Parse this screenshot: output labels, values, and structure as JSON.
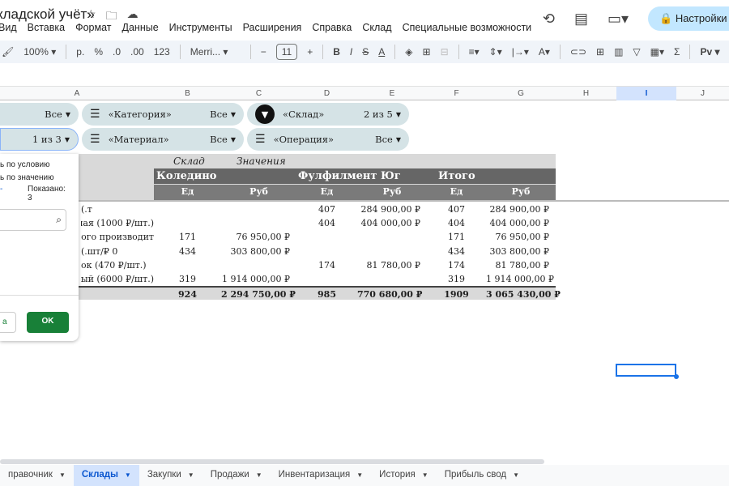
{
  "doc": {
    "title": "кладской учёт»"
  },
  "menu": [
    "Вид",
    "Вставка",
    "Формат",
    "Данные",
    "Инструменты",
    "Расширения",
    "Справка",
    "Склад",
    "Специальные возможности"
  ],
  "header": {
    "share_label": "Настройки Д"
  },
  "toolbar": {
    "zoom": "100%",
    "currency": "р.",
    "percent": "%",
    "dec_less": ".0",
    "dec_more": ".00",
    "format_123": "123",
    "font": "Merri...",
    "font_size": "11",
    "script": "Рv"
  },
  "columns": [
    "A",
    "B",
    "C",
    "D",
    "E",
    "F",
    "G",
    "H",
    "I",
    "J"
  ],
  "filters": {
    "row1": [
      {
        "label": "",
        "value": "Все"
      },
      {
        "label": "«Категория»",
        "value": "Все"
      },
      {
        "label": "«Склад»",
        "value": "2 из 5"
      }
    ],
    "row2": [
      {
        "label": "",
        "value": "1 из 3"
      },
      {
        "label": "«Материал»",
        "value": "Все"
      },
      {
        "label": "«Операция»",
        "value": "Все"
      }
    ]
  },
  "pivot": {
    "col_field": "Склад",
    "values_field": "Значения",
    "groups": [
      "Коледино",
      "Фулфилмент Юг",
      "Итого"
    ],
    "sub": [
      "Ед",
      "Руб",
      "Ед",
      "Руб",
      "Ед",
      "Руб"
    ],
    "rows": [
      {
        "label": "т.)",
        "c": [
          "",
          "",
          "407",
          "284 900,00 ₽",
          "407",
          "284 900,00 ₽"
        ]
      },
      {
        "label": "тная (1000 ₽/шт.)",
        "c": [
          "",
          "",
          "404",
          "404 000,00 ₽",
          "404",
          "404 000,00 ₽"
        ]
      },
      {
        "label": "вого производит",
        "c": [
          "171",
          "76 950,00 ₽",
          "",
          "",
          "171",
          "76 950,00 ₽"
        ]
      },
      {
        "label": "0 ₽/шт.)",
        "c": [
          "434",
          "303 800,00 ₽",
          "",
          "",
          "434",
          "303 800,00 ₽"
        ]
      },
      {
        "label": "ок (470 ₽/шт.)",
        "c": [
          "",
          "",
          "174",
          "81 780,00 ₽",
          "174",
          "81 780,00 ₽"
        ]
      },
      {
        "label": "ный (6000 ₽/шт.)",
        "c": [
          "319",
          "1 914 000,00 ₽",
          "",
          "",
          "319",
          "1 914 000,00 ₽"
        ]
      }
    ],
    "totals": [
      "924",
      "2 294 750,00 ₽",
      "985",
      "770 680,00 ₽",
      "1909",
      "3 065 430,00 ₽"
    ]
  },
  "popup": {
    "by_condition": "ь по условию",
    "by_value": "ь по значению",
    "link": "-",
    "shown": "Показано: 3",
    "cancel": "а",
    "ok": "OK"
  },
  "tabs": [
    "правочник",
    "Склады",
    "Закупки",
    "Продажи",
    "Инвентаризация",
    "История",
    "Прибыль свод"
  ],
  "colors": {
    "accent": "#0b57d0",
    "ok": "#188038",
    "chip": "#d5e3e6",
    "pivot_dark": "#666666"
  }
}
